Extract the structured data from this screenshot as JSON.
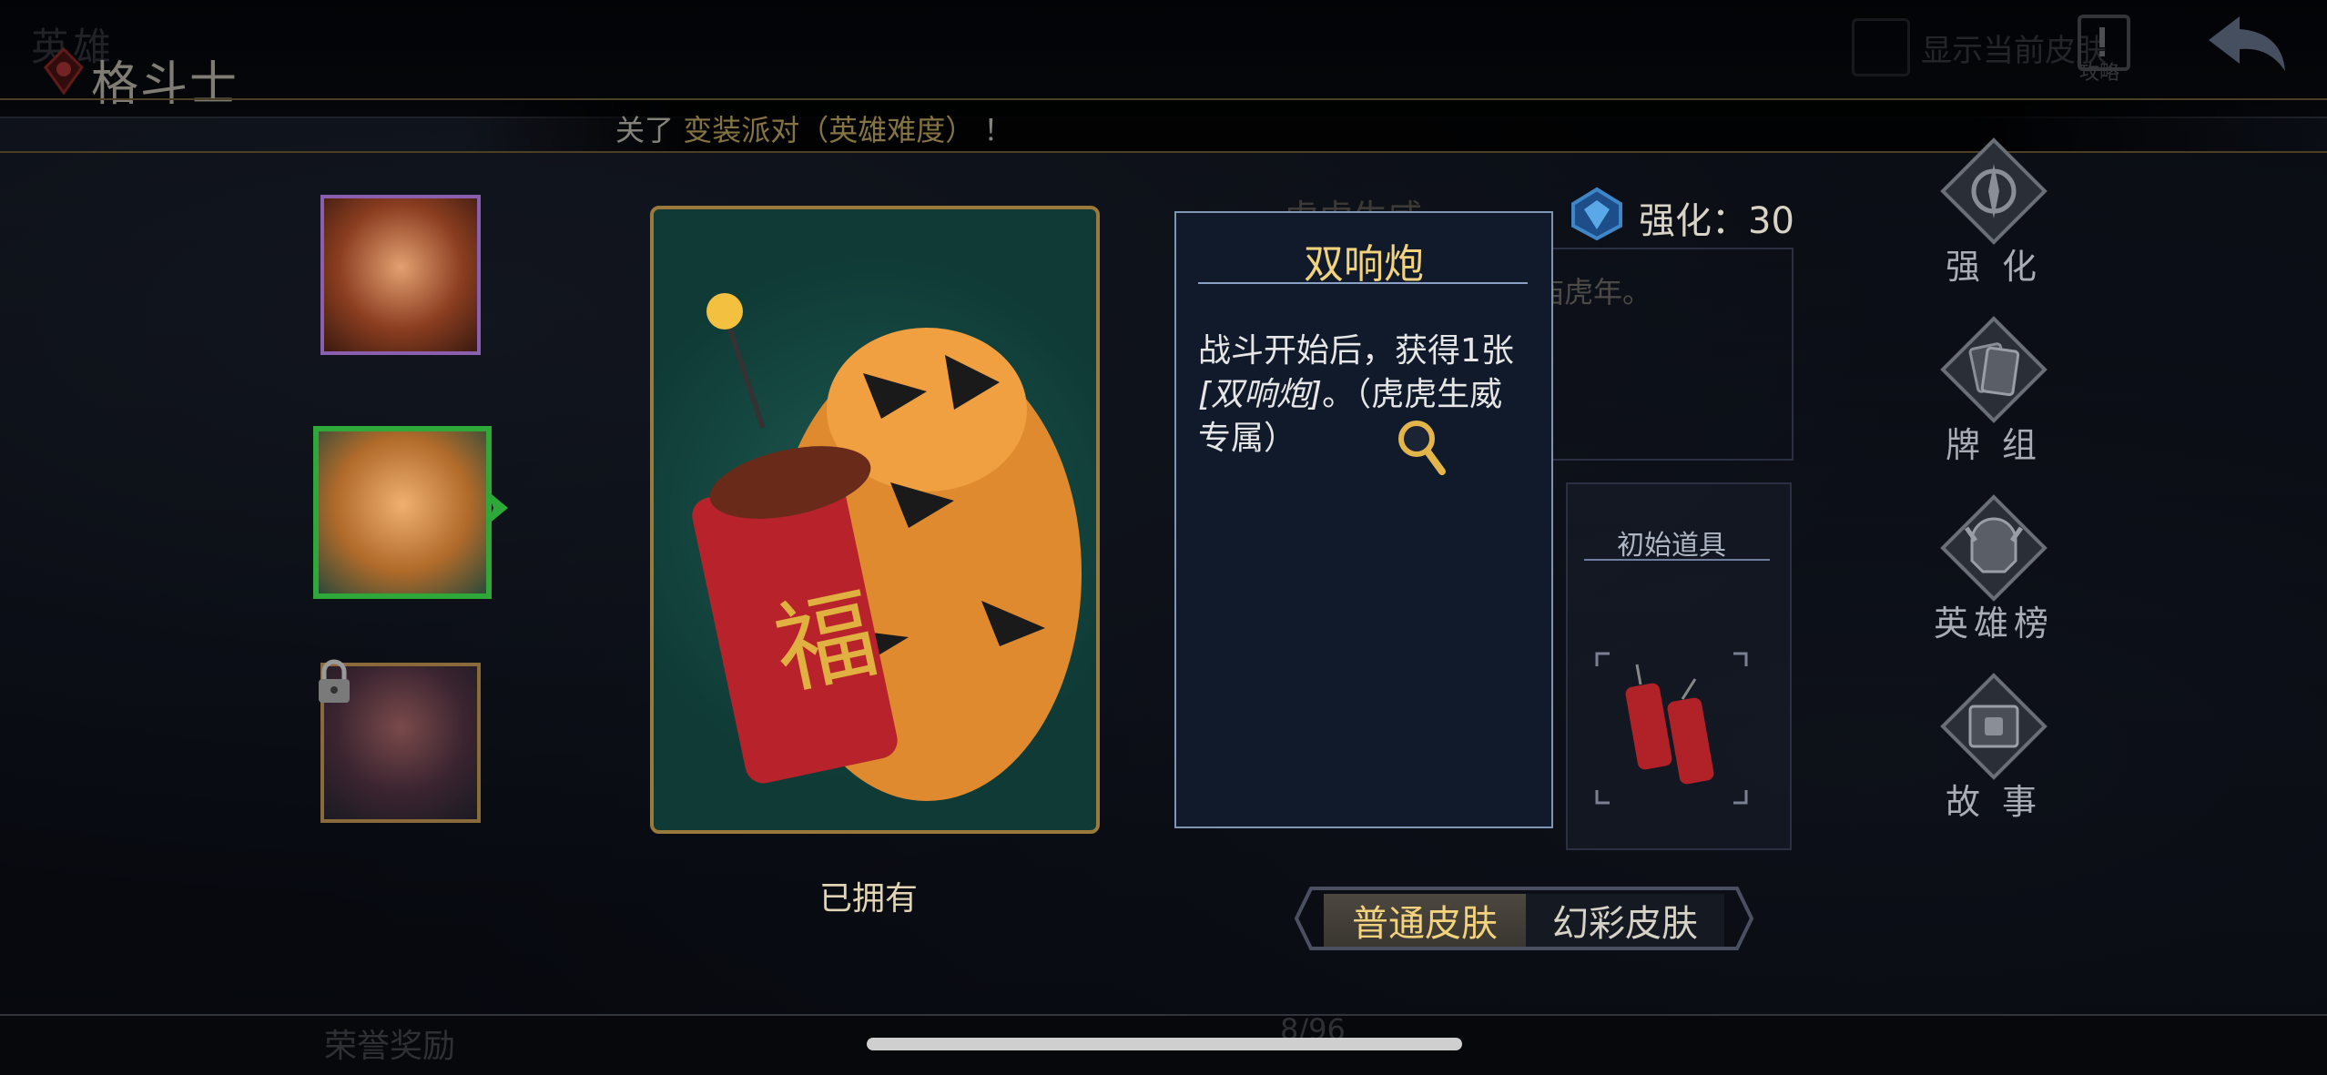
{
  "header": {
    "ghost_title": "英雄",
    "title": "格斗士",
    "show_skin_label": "显示当前皮肤",
    "guide_label": "攻略"
  },
  "notice": {
    "prefix": "关了",
    "highlight": "变装派对（英雄难度）",
    "suffix": "！"
  },
  "portraits": [
    {
      "name": "hero-portrait-red-mask",
      "locked": false,
      "selected": false
    },
    {
      "name": "hero-portrait-tiger",
      "locked": false,
      "selected": true
    },
    {
      "name": "hero-portrait-hooded",
      "locked": true,
      "selected": false
    }
  ],
  "card": {
    "owned_label": "已拥有",
    "card_name_ghost": "虎虎生威",
    "desc_ghost": "庙虎年。"
  },
  "rank": {
    "label": "强化：30"
  },
  "items": {
    "title": "初始道具"
  },
  "popup": {
    "title": "双响炮",
    "text_a": "战斗开始后，获得1张",
    "text_italic": "[双响炮]",
    "text_b": "。（虎虎生威专属）"
  },
  "tabs": {
    "normal": "普通皮肤",
    "color": "幻彩皮肤"
  },
  "side_menu": [
    {
      "label": "强 化",
      "icon": "compass-icon"
    },
    {
      "label": "牌 组",
      "icon": "cards-icon"
    },
    {
      "label": "英雄榜",
      "icon": "helmet-icon"
    },
    {
      "label": "故 事",
      "icon": "book-icon"
    }
  ],
  "bottom": {
    "reward_ghost": "荣誉奖励",
    "page_ghost": "8/96"
  },
  "colors": {
    "accent_gold": "#f2d27c",
    "selected_green": "#2fa83a",
    "popup_bg": "#101a2a"
  }
}
